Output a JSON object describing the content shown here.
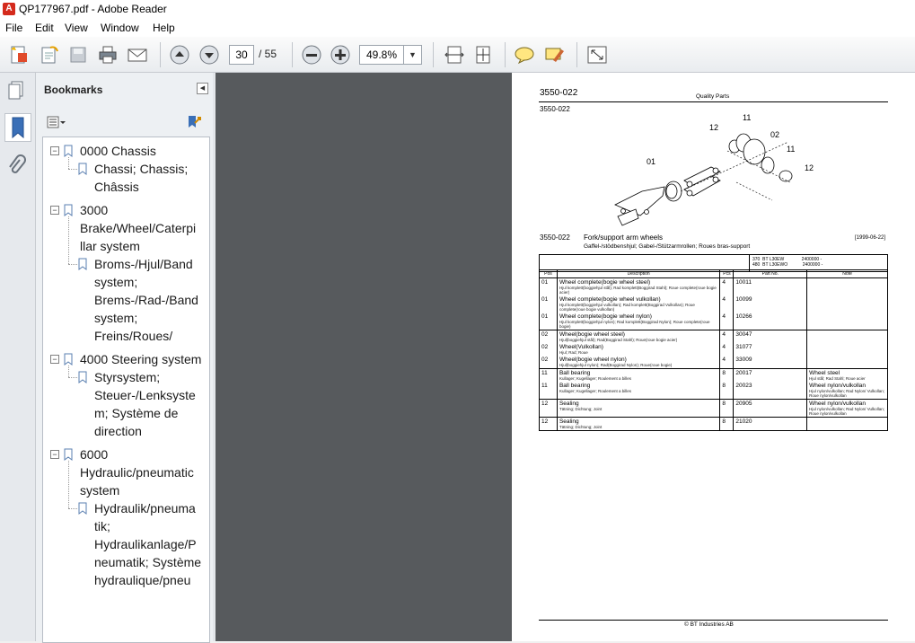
{
  "window": {
    "title": "QP177967.pdf - Adobe Reader",
    "app_icon": "pdf-icon"
  },
  "menu": [
    "File",
    "Edit",
    "View",
    "Window",
    "Help"
  ],
  "toolbar": {
    "page_current": "30",
    "page_total": "/ 55",
    "zoom": "49.8%"
  },
  "bookmarks": {
    "header": "Bookmarks",
    "items": [
      {
        "lines": [
          "0000 Chassis"
        ],
        "children": [
          {
            "lines": [
              "Chassi; Chassis;",
              "Châssis"
            ]
          }
        ]
      },
      {
        "lines": [
          "3000",
          "Brake/Wheel/Caterpi",
          "llar system"
        ],
        "children": [
          {
            "lines": [
              "Broms-/Hjul/Band",
              "system;",
              "Brems-/Rad-/Band",
              "system;",
              "Freins/Roues/"
            ]
          }
        ]
      },
      {
        "lines": [
          "4000 Steering system"
        ],
        "children": [
          {
            "lines": [
              "Styrsystem;",
              "Steuer-/Lenksyste",
              "m; Système de",
              "direction"
            ]
          }
        ]
      },
      {
        "lines": [
          "6000",
          "Hydraulic/pneumatic",
          "system"
        ],
        "children": [
          {
            "lines": [
              "Hydraulik/pneuma",
              "tik;",
              "Hydraulikanlage/P",
              "neumatik; Système",
              "hydraulique/pneu"
            ]
          }
        ]
      }
    ]
  },
  "doc": {
    "header_code": "3550-022",
    "header_right": "Quality Parts",
    "sub_code": "3550-022",
    "callouts": [
      "12",
      "11",
      "02",
      "01",
      "11",
      "12"
    ],
    "section_code": "3550-022",
    "section_title": "Fork/support arm wheels",
    "section_subtitle": "Gaffel-/stödbenshjul; Gabel-/Stützarmrollen; Roues bras-support",
    "date": "[1999-06-22]",
    "models": [
      {
        "code": "370",
        "name": "BT L30EW",
        "serial": "2400000 -"
      },
      {
        "code": "480",
        "name": "BT L30EWO",
        "serial": "2400000 -"
      }
    ],
    "table_headers": [
      "Pos",
      "Description",
      "Pcs",
      "Part No.",
      "Note"
    ],
    "rows": [
      {
        "pos": "01",
        "desc": "Wheel complete(bogie wheel steel)",
        "sub": "Hjul komplett(boggiehjul stål); Rad komplett(Boggirad Stahl); Roue complete(roue bogie acier)",
        "pcs": "4",
        "part": "10011",
        "note": "",
        "note_sub": "",
        "grp": true
      },
      {
        "pos": "01",
        "desc": "Wheel complete(bogie wheel vulkollan)",
        "sub": "Hjul komplett(boggiehjul vulkollan); Rad komplett(Boggirad Vulkollan); Roue complete(roue bogie vulkollan)",
        "pcs": "4",
        "part": "10099",
        "note": "",
        "note_sub": "",
        "grp": false
      },
      {
        "pos": "01",
        "desc": "Wheel complete(bogie wheel nylon)",
        "sub": "Hjul komplett(boggiehjul nylon); Rad komplett(Boggirad Nylon); Roue complete(roue bogie)",
        "pcs": "4",
        "part": "10266",
        "note": "",
        "note_sub": "",
        "grp": false
      },
      {
        "pos": "02",
        "desc": "Wheel(bogie wheel steel)",
        "sub": "Hjul(boggiehjul stål); Rad(Boggirad Stahl); Roue(roue bogie acier)",
        "pcs": "4",
        "part": "30047",
        "note": "",
        "note_sub": "",
        "grp": true
      },
      {
        "pos": "02",
        "desc": "Wheel(Vulkollan)",
        "sub": "Hjul; Rad; Roue",
        "pcs": "4",
        "part": "31077",
        "note": "",
        "note_sub": "",
        "grp": false
      },
      {
        "pos": "02",
        "desc": "Wheel(bogie wheel nylon)",
        "sub": "Hjul(boggiehjul nylon); Rad(Boggirad Nylon); Roue(roue bogie)",
        "pcs": "4",
        "part": "33009",
        "note": "",
        "note_sub": "",
        "grp": false
      },
      {
        "pos": "11",
        "desc": "Ball bearing",
        "sub": "Kullager; Kugellager; Roulement a billes",
        "pcs": "8",
        "part": "20017",
        "note": "Wheel steel",
        "note_sub": "Hjul stål; Rad Stahl; Roue acier",
        "grp": true
      },
      {
        "pos": "11",
        "desc": "Ball bearing",
        "sub": "Kullager; Kugellager; Roulement a billes",
        "pcs": "8",
        "part": "20023",
        "note": "Wheel nylon/vulkollan",
        "note_sub": "Hjul nylon/vulkollan; Rad Nylon/ Vulkollan; Roue nylon/vulkollan",
        "grp": false
      },
      {
        "pos": "12",
        "desc": "Sealing",
        "sub": "Tätning; Dichtung; Joint",
        "pcs": "8",
        "part": "20905",
        "note": "Wheel nylon/vulkollan",
        "note_sub": "Hjul nylon/vulkollan; Rad Nylon/ Vulkollan; Roue nylon/vulkollan",
        "grp": true
      },
      {
        "pos": "12",
        "desc": "Sealing",
        "sub": "Tätning; Dichtung; Joint",
        "pcs": "8",
        "part": "21020",
        "note": "",
        "note_sub": "",
        "grp": true
      }
    ],
    "footer": "© BT Industries AB"
  }
}
